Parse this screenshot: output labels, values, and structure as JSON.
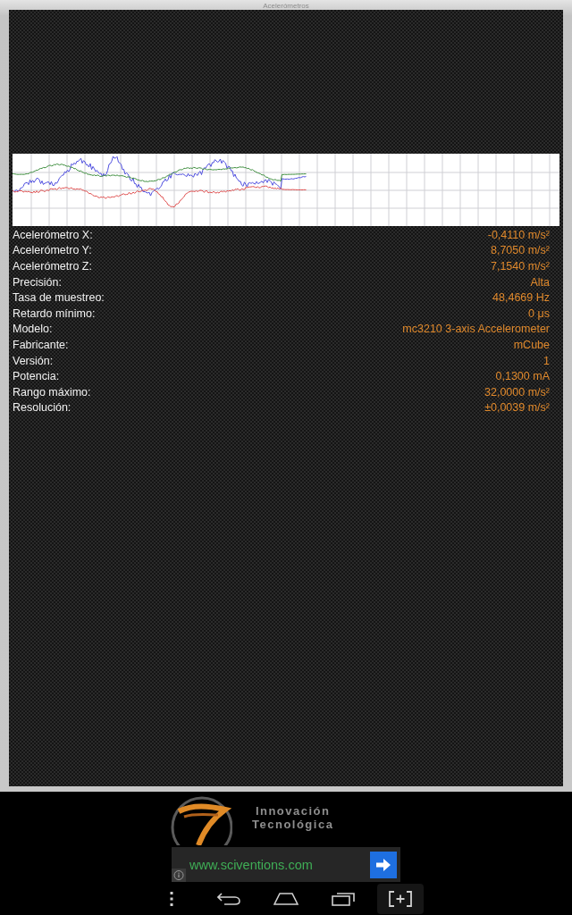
{
  "window": {
    "title": "Acelerómetros"
  },
  "graph": {
    "traces": [
      {
        "color": "#5050e0"
      },
      {
        "color": "#3f8f3f"
      },
      {
        "color": "#e05050"
      }
    ]
  },
  "readings": [
    {
      "label": "Acelerómetro X:",
      "value": "-0,4110 m/s²"
    },
    {
      "label": "Acelerómetro Y:",
      "value": "8,7050 m/s²"
    },
    {
      "label": "Acelerómetro Z:",
      "value": "7,1540 m/s²"
    },
    {
      "label": "Precisión:",
      "value": "Alta"
    },
    {
      "label": "Tasa de muestreo:",
      "value": "48,4669 Hz"
    },
    {
      "label": "Retardo mínimo:",
      "value": "0 μs"
    },
    {
      "label": "Modelo:",
      "value": "mc3210 3-axis Accelerometer"
    },
    {
      "label": "Fabricante:",
      "value": "mCube"
    },
    {
      "label": "Versión:",
      "value": "1"
    },
    {
      "label": "Potencia:",
      "value": "0,1300 mA"
    },
    {
      "label": "Rango máximo:",
      "value": "32,0000 m/s²"
    },
    {
      "label": "Resolución:",
      "value": "±0,0039 m/s²"
    }
  ],
  "ad": {
    "headline": [
      "Innovación",
      "Tecnológica"
    ],
    "link": "www.sciventions.com"
  }
}
